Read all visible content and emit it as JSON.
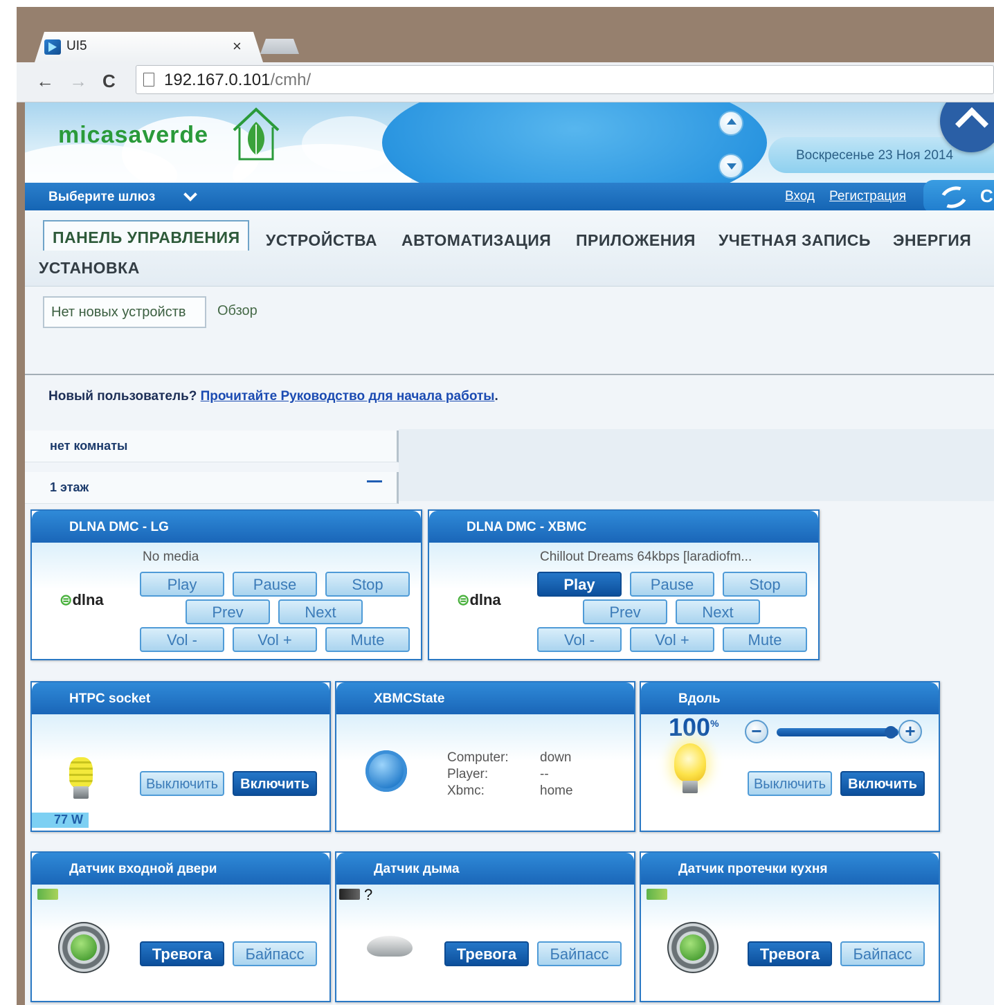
{
  "browser": {
    "tab_title": "UI5",
    "tab_close": "×",
    "url_host": "192.167.0.101",
    "url_path": "/cmh/",
    "back": "←",
    "forward": "→",
    "reload": "C"
  },
  "header": {
    "logo_text": "micasaverde",
    "date": "Воскресенье 23 Ноя 2014",
    "gateway_select": "Выберите шлюз",
    "login": "Вход",
    "register": "Регистрация",
    "refresh_partial": "C"
  },
  "main_nav": [
    {
      "label": "ПАНЕЛЬ УПРАВЛЕНИЯ",
      "active": true
    },
    {
      "label": "УСТРОЙСТВА"
    },
    {
      "label": "АВТОМАТИЗАЦИЯ"
    },
    {
      "label": "ПРИЛОЖЕНИЯ"
    },
    {
      "label": "УЧЕТНАЯ ЗАПИСЬ"
    },
    {
      "label": "ЭНЕРГИЯ"
    },
    {
      "label": "УСТАНОВКА"
    }
  ],
  "sub_nav": [
    {
      "label": "Нет новых устройств",
      "active": true
    },
    {
      "label": "Обзор"
    }
  ],
  "new_user": {
    "prefix": "Новый пользователь? ",
    "link": "Прочитайте Руководство для начала работы",
    "suffix": "."
  },
  "rooms": [
    {
      "label": "нет комнаты"
    },
    {
      "label": "1 этаж",
      "collapse": "−"
    }
  ],
  "devices": {
    "dlna_lg": {
      "title": "DLNA DMC - LG",
      "status": "No media",
      "logo": "dlna",
      "buttons": [
        "Play",
        "Pause",
        "Stop",
        "Prev",
        "Next",
        "Vol -",
        "Vol +",
        "Mute"
      ]
    },
    "dlna_xbmc": {
      "title": "DLNA DMC - XBMC",
      "status": "Chillout Dreams 64kbps [laradiofm...",
      "logo": "dlna",
      "buttons": [
        "Play",
        "Pause",
        "Stop",
        "Prev",
        "Next",
        "Vol -",
        "Vol +",
        "Mute"
      ],
      "active_button": "Play"
    },
    "htpc": {
      "title": "HTPC socket",
      "off": "Выключить",
      "on": "Включить",
      "watts": "77 W"
    },
    "xbmcstate": {
      "title": "XBMCState",
      "rows": [
        {
          "k": "Computer:",
          "v": "down"
        },
        {
          "k": "Player:",
          "v": "--"
        },
        {
          "k": "Xbmc:",
          "v": "home"
        }
      ]
    },
    "vdol": {
      "title": "Вдоль",
      "level": "100",
      "level_unit": "%",
      "level_fraction": 1.0,
      "minus": "−",
      "plus": "+",
      "off": "Выключить",
      "on": "Включить"
    },
    "door": {
      "title": "Датчик входной двери",
      "arm": "Тревога",
      "bypass": "Байпасс"
    },
    "smoke": {
      "title": "Датчик дыма",
      "battery_unknown": "?",
      "arm": "Тревога",
      "bypass": "Байпасс"
    },
    "leak": {
      "title": "Датчик протечки кухня",
      "arm": "Тревога",
      "bypass": "Байпасс"
    }
  }
}
